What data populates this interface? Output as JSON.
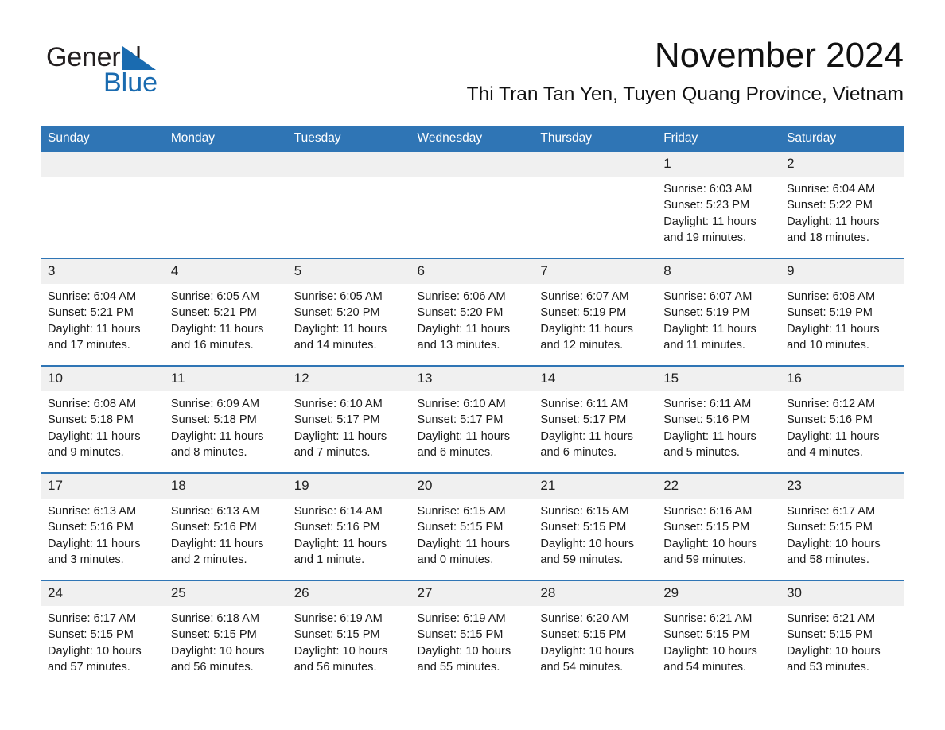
{
  "brand": {
    "name_part1": "General",
    "name_part2": "Blue",
    "accent_color": "#1a6bb0",
    "logo_icon": "triangle-flag-icon"
  },
  "header": {
    "month_title": "November 2024",
    "location": "Thi Tran Tan Yen, Tuyen Quang Province, Vietnam"
  },
  "calendar": {
    "header_color": "#2f75b5",
    "daynum_band_color": "#f0f0f0",
    "weekday_headers": [
      "Sunday",
      "Monday",
      "Tuesday",
      "Wednesday",
      "Thursday",
      "Friday",
      "Saturday"
    ],
    "weeks": [
      [
        {
          "day": "",
          "sunrise": "",
          "sunset": "",
          "daylight": "",
          "blank": true
        },
        {
          "day": "",
          "sunrise": "",
          "sunset": "",
          "daylight": "",
          "blank": true
        },
        {
          "day": "",
          "sunrise": "",
          "sunset": "",
          "daylight": "",
          "blank": true
        },
        {
          "day": "",
          "sunrise": "",
          "sunset": "",
          "daylight": "",
          "blank": true
        },
        {
          "day": "",
          "sunrise": "",
          "sunset": "",
          "daylight": "",
          "blank": true
        },
        {
          "day": "1",
          "sunrise": "Sunrise: 6:03 AM",
          "sunset": "Sunset: 5:23 PM",
          "daylight": "Daylight: 11 hours and 19 minutes.",
          "blank": false
        },
        {
          "day": "2",
          "sunrise": "Sunrise: 6:04 AM",
          "sunset": "Sunset: 5:22 PM",
          "daylight": "Daylight: 11 hours and 18 minutes.",
          "blank": false
        }
      ],
      [
        {
          "day": "3",
          "sunrise": "Sunrise: 6:04 AM",
          "sunset": "Sunset: 5:21 PM",
          "daylight": "Daylight: 11 hours and 17 minutes.",
          "blank": false
        },
        {
          "day": "4",
          "sunrise": "Sunrise: 6:05 AM",
          "sunset": "Sunset: 5:21 PM",
          "daylight": "Daylight: 11 hours and 16 minutes.",
          "blank": false
        },
        {
          "day": "5",
          "sunrise": "Sunrise: 6:05 AM",
          "sunset": "Sunset: 5:20 PM",
          "daylight": "Daylight: 11 hours and 14 minutes.",
          "blank": false
        },
        {
          "day": "6",
          "sunrise": "Sunrise: 6:06 AM",
          "sunset": "Sunset: 5:20 PM",
          "daylight": "Daylight: 11 hours and 13 minutes.",
          "blank": false
        },
        {
          "day": "7",
          "sunrise": "Sunrise: 6:07 AM",
          "sunset": "Sunset: 5:19 PM",
          "daylight": "Daylight: 11 hours and 12 minutes.",
          "blank": false
        },
        {
          "day": "8",
          "sunrise": "Sunrise: 6:07 AM",
          "sunset": "Sunset: 5:19 PM",
          "daylight": "Daylight: 11 hours and 11 minutes.",
          "blank": false
        },
        {
          "day": "9",
          "sunrise": "Sunrise: 6:08 AM",
          "sunset": "Sunset: 5:19 PM",
          "daylight": "Daylight: 11 hours and 10 minutes.",
          "blank": false
        }
      ],
      [
        {
          "day": "10",
          "sunrise": "Sunrise: 6:08 AM",
          "sunset": "Sunset: 5:18 PM",
          "daylight": "Daylight: 11 hours and 9 minutes.",
          "blank": false
        },
        {
          "day": "11",
          "sunrise": "Sunrise: 6:09 AM",
          "sunset": "Sunset: 5:18 PM",
          "daylight": "Daylight: 11 hours and 8 minutes.",
          "blank": false
        },
        {
          "day": "12",
          "sunrise": "Sunrise: 6:10 AM",
          "sunset": "Sunset: 5:17 PM",
          "daylight": "Daylight: 11 hours and 7 minutes.",
          "blank": false
        },
        {
          "day": "13",
          "sunrise": "Sunrise: 6:10 AM",
          "sunset": "Sunset: 5:17 PM",
          "daylight": "Daylight: 11 hours and 6 minutes.",
          "blank": false
        },
        {
          "day": "14",
          "sunrise": "Sunrise: 6:11 AM",
          "sunset": "Sunset: 5:17 PM",
          "daylight": "Daylight: 11 hours and 6 minutes.",
          "blank": false
        },
        {
          "day": "15",
          "sunrise": "Sunrise: 6:11 AM",
          "sunset": "Sunset: 5:16 PM",
          "daylight": "Daylight: 11 hours and 5 minutes.",
          "blank": false
        },
        {
          "day": "16",
          "sunrise": "Sunrise: 6:12 AM",
          "sunset": "Sunset: 5:16 PM",
          "daylight": "Daylight: 11 hours and 4 minutes.",
          "blank": false
        }
      ],
      [
        {
          "day": "17",
          "sunrise": "Sunrise: 6:13 AM",
          "sunset": "Sunset: 5:16 PM",
          "daylight": "Daylight: 11 hours and 3 minutes.",
          "blank": false
        },
        {
          "day": "18",
          "sunrise": "Sunrise: 6:13 AM",
          "sunset": "Sunset: 5:16 PM",
          "daylight": "Daylight: 11 hours and 2 minutes.",
          "blank": false
        },
        {
          "day": "19",
          "sunrise": "Sunrise: 6:14 AM",
          "sunset": "Sunset: 5:16 PM",
          "daylight": "Daylight: 11 hours and 1 minute.",
          "blank": false
        },
        {
          "day": "20",
          "sunrise": "Sunrise: 6:15 AM",
          "sunset": "Sunset: 5:15 PM",
          "daylight": "Daylight: 11 hours and 0 minutes.",
          "blank": false
        },
        {
          "day": "21",
          "sunrise": "Sunrise: 6:15 AM",
          "sunset": "Sunset: 5:15 PM",
          "daylight": "Daylight: 10 hours and 59 minutes.",
          "blank": false
        },
        {
          "day": "22",
          "sunrise": "Sunrise: 6:16 AM",
          "sunset": "Sunset: 5:15 PM",
          "daylight": "Daylight: 10 hours and 59 minutes.",
          "blank": false
        },
        {
          "day": "23",
          "sunrise": "Sunrise: 6:17 AM",
          "sunset": "Sunset: 5:15 PM",
          "daylight": "Daylight: 10 hours and 58 minutes.",
          "blank": false
        }
      ],
      [
        {
          "day": "24",
          "sunrise": "Sunrise: 6:17 AM",
          "sunset": "Sunset: 5:15 PM",
          "daylight": "Daylight: 10 hours and 57 minutes.",
          "blank": false
        },
        {
          "day": "25",
          "sunrise": "Sunrise: 6:18 AM",
          "sunset": "Sunset: 5:15 PM",
          "daylight": "Daylight: 10 hours and 56 minutes.",
          "blank": false
        },
        {
          "day": "26",
          "sunrise": "Sunrise: 6:19 AM",
          "sunset": "Sunset: 5:15 PM",
          "daylight": "Daylight: 10 hours and 56 minutes.",
          "blank": false
        },
        {
          "day": "27",
          "sunrise": "Sunrise: 6:19 AM",
          "sunset": "Sunset: 5:15 PM",
          "daylight": "Daylight: 10 hours and 55 minutes.",
          "blank": false
        },
        {
          "day": "28",
          "sunrise": "Sunrise: 6:20 AM",
          "sunset": "Sunset: 5:15 PM",
          "daylight": "Daylight: 10 hours and 54 minutes.",
          "blank": false
        },
        {
          "day": "29",
          "sunrise": "Sunrise: 6:21 AM",
          "sunset": "Sunset: 5:15 PM",
          "daylight": "Daylight: 10 hours and 54 minutes.",
          "blank": false
        },
        {
          "day": "30",
          "sunrise": "Sunrise: 6:21 AM",
          "sunset": "Sunset: 5:15 PM",
          "daylight": "Daylight: 10 hours and 53 minutes.",
          "blank": false
        }
      ]
    ]
  }
}
